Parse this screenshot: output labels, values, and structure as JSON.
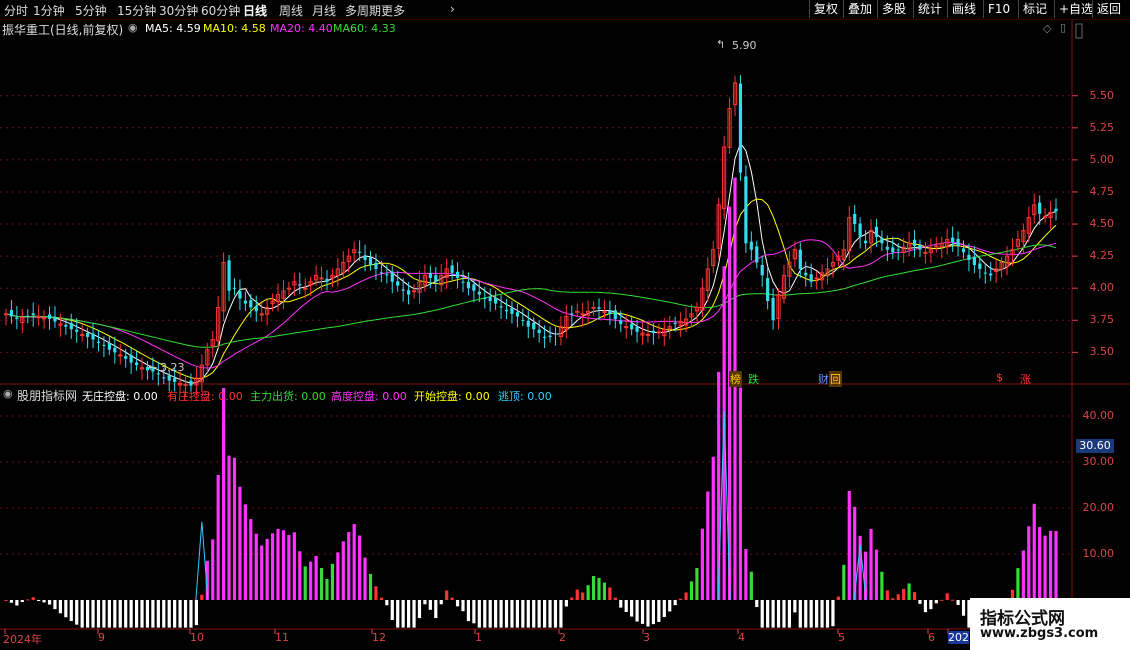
{
  "toolbar": {
    "periods": [
      "分时",
      "1分钟",
      "5分钟",
      "15分钟",
      "30分钟",
      "60分钟",
      "日线",
      "周线",
      "月线",
      "多周期",
      "更多"
    ],
    "active_period": "日线",
    "more_arrow": "›",
    "buttons": [
      "复权",
      "叠加",
      "多股",
      "统计",
      "画线",
      "F10",
      "标记",
      "+自选",
      "返回"
    ]
  },
  "main_panel": {
    "title": "振华重工(日线,前复权)",
    "ma_toggle_icon": "circle-chevron-icon",
    "ma": [
      {
        "label": "MA5: 4.59",
        "color": "#ffffff"
      },
      {
        "label": "MA10: 4.58",
        "color": "#ffff00"
      },
      {
        "label": "MA20: 4.40",
        "color": "#ff33ff"
      },
      {
        "label": "MA60: 4.33",
        "color": "#33dd33"
      }
    ],
    "price_axis": [
      "5.50",
      "5.25",
      "5.00",
      "4.75",
      "4.50",
      "4.25",
      "4.00",
      "3.75",
      "3.50"
    ],
    "high_marker": "5.90",
    "low_marker": "3.23",
    "event_badges": [
      {
        "text": "榜",
        "color": "#ffcc00"
      },
      {
        "text": "跌",
        "color": "#33dd33"
      },
      {
        "text": "财",
        "color": "#6699ff"
      },
      {
        "text": "回",
        "color": "#ffcc00"
      },
      {
        "text": "$",
        "color": "#ff3333"
      },
      {
        "text": "涨",
        "color": "#ff3333"
      }
    ]
  },
  "indicator_panel": {
    "title": "股朋指标网",
    "values": [
      {
        "label": "无庄控盘: 0.00",
        "color": "#ffffff"
      },
      {
        "label": "有庄控盘: 0.00",
        "color": "#ff3333"
      },
      {
        "label": "主力出货: 0.00",
        "color": "#33dd33"
      },
      {
        "label": "高度控盘: 0.00",
        "color": "#ff33ff"
      },
      {
        "label": "开始控盘: 0.00",
        "color": "#ffff00"
      },
      {
        "label": "逃顶: 0.00",
        "color": "#33ccff"
      }
    ],
    "axis": [
      "40.00",
      "30.00",
      "20.00",
      "10.00"
    ],
    "current_value": "30.60"
  },
  "date_axis": [
    "2024年",
    "9",
    "10",
    "11",
    "12",
    "1",
    "2",
    "3",
    "4",
    "5",
    "6",
    "202"
  ],
  "watermark": {
    "title": "指标公式网",
    "url": "www.zbgs3.com"
  },
  "chart_data": {
    "type": "candlestick",
    "price_ylim": [
      3.3,
      5.95
    ],
    "ma_current": {
      "MA5": 4.59,
      "MA10": 4.58,
      "MA20": 4.4,
      "MA60": 4.33
    },
    "closes": [
      3.8,
      3.78,
      3.76,
      3.77,
      3.78,
      3.79,
      3.78,
      3.77,
      3.76,
      3.74,
      3.72,
      3.7,
      3.68,
      3.66,
      3.64,
      3.62,
      3.6,
      3.58,
      3.55,
      3.52,
      3.5,
      3.48,
      3.45,
      3.42,
      3.4,
      3.38,
      3.36,
      3.35,
      3.33,
      3.3,
      3.28,
      3.27,
      3.26,
      3.25,
      3.24,
      3.3,
      3.4,
      3.52,
      3.6,
      3.85,
      4.2,
      3.98,
      4.0,
      3.92,
      3.88,
      3.85,
      3.82,
      3.8,
      3.85,
      3.9,
      3.95,
      3.98,
      4.0,
      4.05,
      4.02,
      4.0,
      4.05,
      4.1,
      4.08,
      4.05,
      4.1,
      4.15,
      4.2,
      4.25,
      4.3,
      4.28,
      4.22,
      4.18,
      4.15,
      4.12,
      4.1,
      4.05,
      4.02,
      3.98,
      3.95,
      3.98,
      4.05,
      4.1,
      4.08,
      4.05,
      4.1,
      4.15,
      4.12,
      4.08,
      4.05,
      4.0,
      3.98,
      3.95,
      3.92,
      3.9,
      3.88,
      3.85,
      3.82,
      3.8,
      3.78,
      3.75,
      3.7,
      3.68,
      3.65,
      3.62,
      3.62,
      3.64,
      3.7,
      3.78,
      3.8,
      3.82,
      3.8,
      3.82,
      3.85,
      3.84,
      3.82,
      3.8,
      3.76,
      3.72,
      3.7,
      3.68,
      3.66,
      3.65,
      3.64,
      3.65,
      3.66,
      3.68,
      3.7,
      3.72,
      3.74,
      3.76,
      3.8,
      3.85,
      4.0,
      4.15,
      4.3,
      4.65,
      5.1,
      5.4,
      5.6,
      4.9,
      4.35,
      4.3,
      4.2,
      4.1,
      3.9,
      3.75,
      3.95,
      4.1,
      4.2,
      4.3,
      4.15,
      4.1,
      4.05,
      4.08,
      4.12,
      4.15,
      4.2,
      4.25,
      4.3,
      4.55,
      4.5,
      4.4,
      4.35,
      4.45,
      4.4,
      4.35,
      4.3,
      4.28,
      4.3,
      4.32,
      4.35,
      4.33,
      4.3,
      4.28,
      4.3,
      4.33,
      4.35,
      4.38,
      4.36,
      4.33,
      4.28,
      4.22,
      4.18,
      4.15,
      4.12,
      4.1,
      4.15,
      4.2,
      4.25,
      4.3,
      4.38,
      4.45,
      4.55,
      4.65,
      4.58,
      4.56,
      4.59,
      4.6
    ],
    "indicator_ylim": [
      -5,
      45
    ],
    "indicator_peaks": [
      {
        "type": "逃顶",
        "value": 41
      },
      {
        "type": "逃顶",
        "value": 17
      },
      {
        "type": "逃顶",
        "value": 12
      }
    ]
  }
}
